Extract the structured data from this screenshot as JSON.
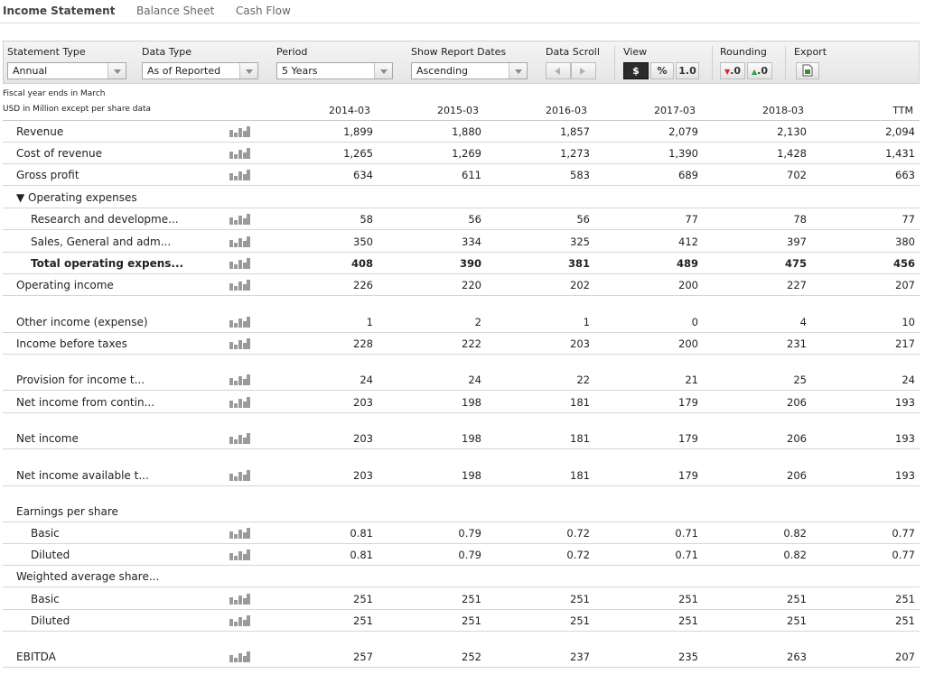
{
  "tabs": [
    "Income Statement",
    "Balance Sheet",
    "Cash Flow"
  ],
  "toolbar": {
    "statement_type": {
      "label": "Statement Type",
      "value": "Annual"
    },
    "data_type": {
      "label": "Data Type",
      "value": "As of Reported"
    },
    "period": {
      "label": "Period",
      "value": "5 Years"
    },
    "report_dates": {
      "label": "Show Report Dates",
      "value": "Ascending"
    },
    "data_scroll": {
      "label": "Data Scroll"
    },
    "view": {
      "label": "View",
      "dollar": "$",
      "percent": "%",
      "decimal": "1.0"
    },
    "rounding": {
      "label": "Rounding",
      "down": ".0",
      "up": ".0"
    },
    "export": {
      "label": "Export"
    }
  },
  "info": {
    "fiscal": "Fiscal year ends in March",
    "units": "USD in Million except per share data"
  },
  "columns": [
    "2014-03",
    "2015-03",
    "2016-03",
    "2017-03",
    "2018-03",
    "TTM"
  ],
  "rows": [
    {
      "label": "Revenue",
      "values": [
        "1,899",
        "1,880",
        "1,857",
        "2,079",
        "2,130",
        "2,094"
      ],
      "chart": true,
      "indent": false,
      "bold": false
    },
    {
      "label": "Cost of revenue",
      "values": [
        "1,265",
        "1,269",
        "1,273",
        "1,390",
        "1,428",
        "1,431"
      ],
      "chart": true,
      "indent": false,
      "bold": false
    },
    {
      "label": "Gross profit",
      "values": [
        "634",
        "611",
        "583",
        "689",
        "702",
        "663"
      ],
      "chart": true,
      "indent": false,
      "bold": false
    },
    {
      "label": "▼ Operating expenses",
      "values": [
        "",
        "",
        "",
        "",
        "",
        ""
      ],
      "chart": false,
      "indent": false,
      "bold": false
    },
    {
      "label": "Research and developme...",
      "values": [
        "58",
        "56",
        "56",
        "77",
        "78",
        "77"
      ],
      "chart": true,
      "indent": true,
      "bold": false
    },
    {
      "label": "Sales, General and adm...",
      "values": [
        "350",
        "334",
        "325",
        "412",
        "397",
        "380"
      ],
      "chart": true,
      "indent": true,
      "bold": false
    },
    {
      "label": "Total operating expens...",
      "values": [
        "408",
        "390",
        "381",
        "489",
        "475",
        "456"
      ],
      "chart": true,
      "indent": true,
      "bold": true
    },
    {
      "label": "Operating income",
      "values": [
        "226",
        "220",
        "202",
        "200",
        "227",
        "207"
      ],
      "chart": true,
      "indent": false,
      "bold": false
    },
    {
      "label": "Other income (expense)",
      "values": [
        "1",
        "2",
        "1",
        "0",
        "4",
        "10"
      ],
      "chart": true,
      "indent": false,
      "bold": false
    },
    {
      "label": "Income before taxes",
      "values": [
        "228",
        "222",
        "203",
        "200",
        "231",
        "217"
      ],
      "chart": true,
      "indent": false,
      "bold": false
    },
    {
      "label": "Provision for income t...",
      "values": [
        "24",
        "24",
        "22",
        "21",
        "25",
        "24"
      ],
      "chart": true,
      "indent": false,
      "bold": false
    },
    {
      "label": "Net income from contin...",
      "values": [
        "203",
        "198",
        "181",
        "179",
        "206",
        "193"
      ],
      "chart": true,
      "indent": false,
      "bold": false
    },
    {
      "label": "Net income",
      "values": [
        "203",
        "198",
        "181",
        "179",
        "206",
        "193"
      ],
      "chart": true,
      "indent": false,
      "bold": false
    },
    {
      "label": "Net income available t...",
      "values": [
        "203",
        "198",
        "181",
        "179",
        "206",
        "193"
      ],
      "chart": true,
      "indent": false,
      "bold": false
    },
    {
      "label": "Earnings per share",
      "values": [
        "",
        "",
        "",
        "",
        "",
        ""
      ],
      "chart": false,
      "indent": false,
      "bold": false
    },
    {
      "label": "Basic",
      "values": [
        "0.81",
        "0.79",
        "0.72",
        "0.71",
        "0.82",
        "0.77"
      ],
      "chart": true,
      "indent": true,
      "bold": false
    },
    {
      "label": "Diluted",
      "values": [
        "0.81",
        "0.79",
        "0.72",
        "0.71",
        "0.82",
        "0.77"
      ],
      "chart": true,
      "indent": true,
      "bold": false
    },
    {
      "label": "Weighted average share...",
      "values": [
        "",
        "",
        "",
        "",
        "",
        ""
      ],
      "chart": false,
      "indent": false,
      "bold": false
    },
    {
      "label": "Basic",
      "values": [
        "251",
        "251",
        "251",
        "251",
        "251",
        "251"
      ],
      "chart": true,
      "indent": true,
      "bold": false
    },
    {
      "label": "Diluted",
      "values": [
        "251",
        "251",
        "251",
        "251",
        "251",
        "251"
      ],
      "chart": true,
      "indent": true,
      "bold": false
    },
    {
      "label": "EBITDA",
      "values": [
        "257",
        "252",
        "237",
        "235",
        "263",
        "207"
      ],
      "chart": true,
      "indent": false,
      "bold": false
    }
  ]
}
